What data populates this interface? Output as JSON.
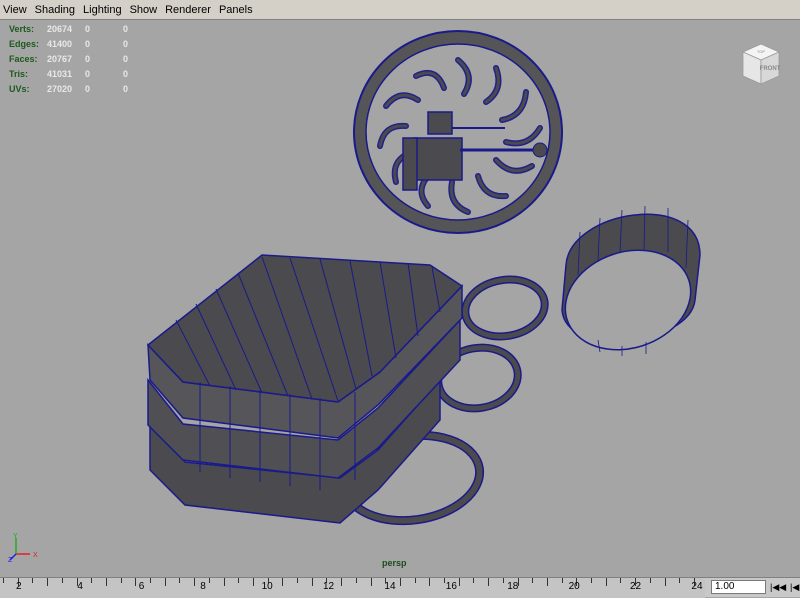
{
  "menu": [
    "View",
    "Shading",
    "Lighting",
    "Show",
    "Renderer",
    "Panels"
  ],
  "hud": [
    {
      "label": "Verts:",
      "v1": "20674",
      "v2": "0",
      "v3": "0"
    },
    {
      "label": "Edges:",
      "v1": "41400",
      "v2": "0",
      "v3": "0"
    },
    {
      "label": "Faces:",
      "v1": "20767",
      "v2": "0",
      "v3": "0"
    },
    {
      "label": "Tris:",
      "v1": "41031",
      "v2": "0",
      "v3": "0"
    },
    {
      "label": "UVs:",
      "v1": "27020",
      "v2": "0",
      "v3": "0"
    }
  ],
  "viewcube": {
    "front": "FRONT",
    "top": "TOP"
  },
  "camera": "persp",
  "axis": {
    "x": "X",
    "y": "Y",
    "z": "Z"
  },
  "timeline": {
    "labels": [
      "2",
      "4",
      "6",
      "8",
      "10",
      "12",
      "14",
      "16",
      "18",
      "20",
      "22",
      "24"
    ],
    "current_frame": "1.00",
    "buttons": [
      "|◀◀",
      "|◀"
    ]
  },
  "colors": {
    "viewport_bg": "#a5a5a5",
    "wire": "#1a1a8a",
    "mesh": "#4a4a4f"
  }
}
